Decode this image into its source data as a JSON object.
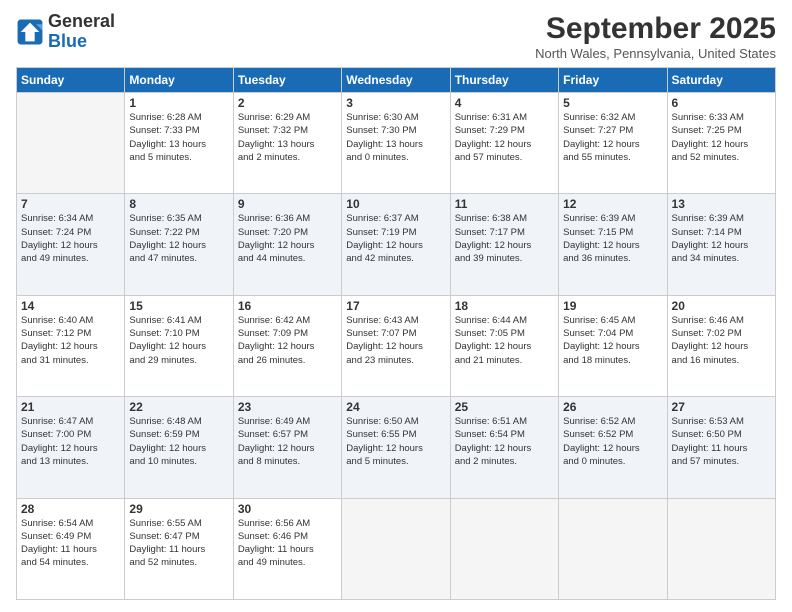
{
  "logo": {
    "line1": "General",
    "line2": "Blue"
  },
  "title": "September 2025",
  "subtitle": "North Wales, Pennsylvania, United States",
  "weekdays": [
    "Sunday",
    "Monday",
    "Tuesday",
    "Wednesday",
    "Thursday",
    "Friday",
    "Saturday"
  ],
  "weeks": [
    [
      {
        "day": "",
        "info": ""
      },
      {
        "day": "1",
        "info": "Sunrise: 6:28 AM\nSunset: 7:33 PM\nDaylight: 13 hours\nand 5 minutes."
      },
      {
        "day": "2",
        "info": "Sunrise: 6:29 AM\nSunset: 7:32 PM\nDaylight: 13 hours\nand 2 minutes."
      },
      {
        "day": "3",
        "info": "Sunrise: 6:30 AM\nSunset: 7:30 PM\nDaylight: 13 hours\nand 0 minutes."
      },
      {
        "day": "4",
        "info": "Sunrise: 6:31 AM\nSunset: 7:29 PM\nDaylight: 12 hours\nand 57 minutes."
      },
      {
        "day": "5",
        "info": "Sunrise: 6:32 AM\nSunset: 7:27 PM\nDaylight: 12 hours\nand 55 minutes."
      },
      {
        "day": "6",
        "info": "Sunrise: 6:33 AM\nSunset: 7:25 PM\nDaylight: 12 hours\nand 52 minutes."
      }
    ],
    [
      {
        "day": "7",
        "info": "Sunrise: 6:34 AM\nSunset: 7:24 PM\nDaylight: 12 hours\nand 49 minutes."
      },
      {
        "day": "8",
        "info": "Sunrise: 6:35 AM\nSunset: 7:22 PM\nDaylight: 12 hours\nand 47 minutes."
      },
      {
        "day": "9",
        "info": "Sunrise: 6:36 AM\nSunset: 7:20 PM\nDaylight: 12 hours\nand 44 minutes."
      },
      {
        "day": "10",
        "info": "Sunrise: 6:37 AM\nSunset: 7:19 PM\nDaylight: 12 hours\nand 42 minutes."
      },
      {
        "day": "11",
        "info": "Sunrise: 6:38 AM\nSunset: 7:17 PM\nDaylight: 12 hours\nand 39 minutes."
      },
      {
        "day": "12",
        "info": "Sunrise: 6:39 AM\nSunset: 7:15 PM\nDaylight: 12 hours\nand 36 minutes."
      },
      {
        "day": "13",
        "info": "Sunrise: 6:39 AM\nSunset: 7:14 PM\nDaylight: 12 hours\nand 34 minutes."
      }
    ],
    [
      {
        "day": "14",
        "info": "Sunrise: 6:40 AM\nSunset: 7:12 PM\nDaylight: 12 hours\nand 31 minutes."
      },
      {
        "day": "15",
        "info": "Sunrise: 6:41 AM\nSunset: 7:10 PM\nDaylight: 12 hours\nand 29 minutes."
      },
      {
        "day": "16",
        "info": "Sunrise: 6:42 AM\nSunset: 7:09 PM\nDaylight: 12 hours\nand 26 minutes."
      },
      {
        "day": "17",
        "info": "Sunrise: 6:43 AM\nSunset: 7:07 PM\nDaylight: 12 hours\nand 23 minutes."
      },
      {
        "day": "18",
        "info": "Sunrise: 6:44 AM\nSunset: 7:05 PM\nDaylight: 12 hours\nand 21 minutes."
      },
      {
        "day": "19",
        "info": "Sunrise: 6:45 AM\nSunset: 7:04 PM\nDaylight: 12 hours\nand 18 minutes."
      },
      {
        "day": "20",
        "info": "Sunrise: 6:46 AM\nSunset: 7:02 PM\nDaylight: 12 hours\nand 16 minutes."
      }
    ],
    [
      {
        "day": "21",
        "info": "Sunrise: 6:47 AM\nSunset: 7:00 PM\nDaylight: 12 hours\nand 13 minutes."
      },
      {
        "day": "22",
        "info": "Sunrise: 6:48 AM\nSunset: 6:59 PM\nDaylight: 12 hours\nand 10 minutes."
      },
      {
        "day": "23",
        "info": "Sunrise: 6:49 AM\nSunset: 6:57 PM\nDaylight: 12 hours\nand 8 minutes."
      },
      {
        "day": "24",
        "info": "Sunrise: 6:50 AM\nSunset: 6:55 PM\nDaylight: 12 hours\nand 5 minutes."
      },
      {
        "day": "25",
        "info": "Sunrise: 6:51 AM\nSunset: 6:54 PM\nDaylight: 12 hours\nand 2 minutes."
      },
      {
        "day": "26",
        "info": "Sunrise: 6:52 AM\nSunset: 6:52 PM\nDaylight: 12 hours\nand 0 minutes."
      },
      {
        "day": "27",
        "info": "Sunrise: 6:53 AM\nSunset: 6:50 PM\nDaylight: 11 hours\nand 57 minutes."
      }
    ],
    [
      {
        "day": "28",
        "info": "Sunrise: 6:54 AM\nSunset: 6:49 PM\nDaylight: 11 hours\nand 54 minutes."
      },
      {
        "day": "29",
        "info": "Sunrise: 6:55 AM\nSunset: 6:47 PM\nDaylight: 11 hours\nand 52 minutes."
      },
      {
        "day": "30",
        "info": "Sunrise: 6:56 AM\nSunset: 6:46 PM\nDaylight: 11 hours\nand 49 minutes."
      },
      {
        "day": "",
        "info": ""
      },
      {
        "day": "",
        "info": ""
      },
      {
        "day": "",
        "info": ""
      },
      {
        "day": "",
        "info": ""
      }
    ]
  ]
}
